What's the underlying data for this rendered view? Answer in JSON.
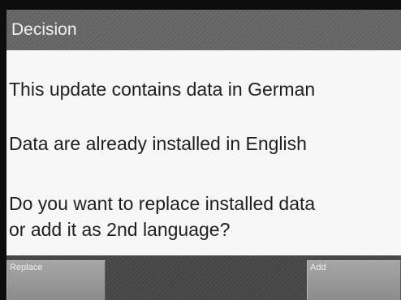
{
  "dialog": {
    "title": "Decision",
    "messages": [
      "This update contains data in German",
      "Data are already installed in English",
      "Do you want to replace installed data",
      "or add it as 2nd language?"
    ]
  },
  "softkeys": {
    "left_label": "Replace",
    "right_label": "Add"
  },
  "colors": {
    "title_bar": "#666666",
    "content_bg": "#f7f7f7",
    "footer_bg": "#484848",
    "softkey": "#999999"
  }
}
